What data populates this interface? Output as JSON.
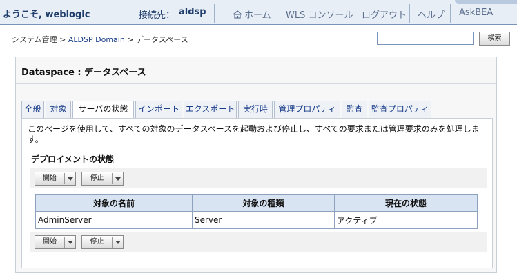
{
  "header": {
    "welcome": "ようこそ, weblogic",
    "connection_label": "接続先：",
    "connection_value": "aldsp",
    "nav": {
      "home": "ホーム",
      "wls_console": "WLS コンソール",
      "logout": "ログアウト",
      "help": "ヘルプ",
      "askbea": "AskBEA"
    }
  },
  "breadcrumb": {
    "root": "システム管理",
    "sep1": ">",
    "domain": "ALDSP Domain",
    "sep2": ">",
    "current": "データスペース"
  },
  "search": {
    "value": "",
    "button_label": "検索"
  },
  "panel": {
    "title": "Dataspace : データスペース"
  },
  "tabs": [
    {
      "label": "全般"
    },
    {
      "label": "対象"
    },
    {
      "label": "サーバの状態",
      "active": true
    },
    {
      "label": "インポート"
    },
    {
      "label": "エクスポート"
    },
    {
      "label": "実行時"
    },
    {
      "label": "管理プロパティ"
    },
    {
      "label": "監査"
    },
    {
      "label": "監査プロパティ"
    }
  ],
  "content": {
    "description": "このページを使用して、すべての対象のデータスペースを起動および停止し、すべての要求または管理要求のみを処理します。",
    "section_title": "デプロイメントの状態",
    "start_button": "開始",
    "stop_button": "停止"
  },
  "table": {
    "columns": [
      "対象の名前",
      "対象の種類",
      "現在の状態"
    ],
    "rows": [
      [
        "AdminServer",
        "Server",
        "アクティブ"
      ]
    ]
  }
}
